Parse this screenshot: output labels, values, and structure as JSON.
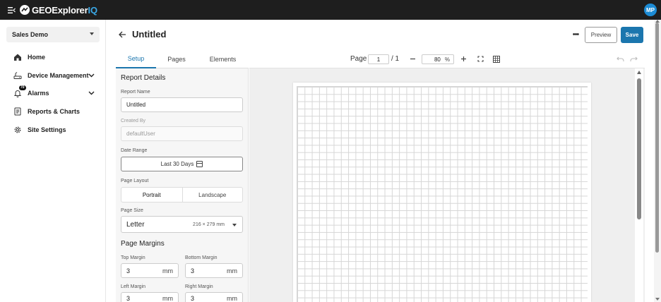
{
  "app": {
    "logo_text": "GEOExplorer",
    "logo_suffix": "IQ",
    "user_initials": "MP"
  },
  "sidebar": {
    "site_name": "Sales Demo",
    "items": [
      {
        "label": "Home",
        "icon": "home-icon"
      },
      {
        "label": "Device Management",
        "icon": "router-icon",
        "expandable": true
      },
      {
        "label": "Alarms",
        "icon": "bell-icon",
        "badge": "70",
        "expandable": true
      },
      {
        "label": "Reports & Charts",
        "icon": "report-icon"
      },
      {
        "label": "Site Settings",
        "icon": "gear-icon"
      }
    ]
  },
  "header": {
    "title": "Untitled",
    "preview_label": "Preview",
    "save_label": "Save"
  },
  "panel": {
    "tabs": [
      {
        "label": "Setup",
        "active": true
      },
      {
        "label": "Pages",
        "active": false
      },
      {
        "label": "Elements",
        "active": false
      }
    ],
    "report_details_title": "Report Details",
    "report_name_label": "Report Name",
    "report_name_value": "Untitled",
    "created_by_label": "Created By",
    "created_by_value": "defaultUser",
    "date_range_label": "Date Range",
    "date_range_value": "Last 30 Days",
    "page_layout_label": "Page Layout",
    "layout_options": [
      "Portrait",
      "Landscape"
    ],
    "layout_selected": "Portrait",
    "page_size_label": "Page Size",
    "page_size_value": "Letter",
    "page_size_dims": "216 × 279 mm",
    "page_margins_title": "Page Margins",
    "margins": {
      "top_label": "Top Margin",
      "top_value": "3",
      "bottom_label": "Bottom Margin",
      "bottom_value": "3",
      "left_label": "Left Margin",
      "left_value": "3",
      "right_label": "Right Margin",
      "right_value": "3",
      "unit": "mm"
    }
  },
  "toolbar": {
    "page_label": "Page",
    "page_current": "1",
    "page_total": "/ 1",
    "zoom_value": "80",
    "zoom_unit": "%"
  },
  "colors": {
    "accent": "#1b76ae",
    "topbar": "#1e1e1e",
    "avatar": "#1c8bd4"
  }
}
